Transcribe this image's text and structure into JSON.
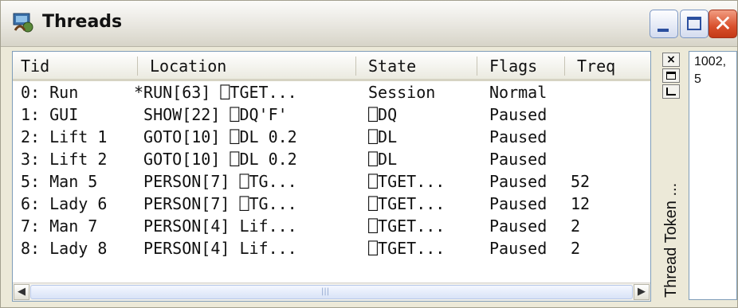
{
  "window": {
    "title": "Threads",
    "icon": "threads-app-icon",
    "controls": {
      "minimize": "minimize-icon",
      "maximize": "maximize-icon",
      "close": "close-icon",
      "close_glyph": "✕"
    }
  },
  "table": {
    "columns": [
      "Tid",
      "Location",
      "State",
      "Flags",
      "Treq"
    ],
    "rows": [
      [
        "0: Run",
        "*RUN[63] ⎕TGET...",
        "Session",
        "Normal",
        ""
      ],
      [
        "1: GUI",
        " SHOW[22] ⎕DQ'F'",
        "⎕DQ",
        "Paused",
        ""
      ],
      [
        "2: Lift 1",
        " GOTO[10] ⎕DL 0.2",
        "⎕DL",
        "Paused",
        ""
      ],
      [
        "3: Lift 2",
        " GOTO[10] ⎕DL 0.2",
        "⎕DL",
        "Paused",
        ""
      ],
      [
        "5: Man 5",
        " PERSON[7] ⎕TG...",
        "⎕TGET...",
        "Paused",
        "52"
      ],
      [
        "6: Lady 6",
        " PERSON[7] ⎕TG...",
        "⎕TGET...",
        "Paused",
        "12"
      ],
      [
        "7: Man 7",
        " PERSON[4] Lif...",
        "⎕TGET...",
        "Paused",
        "2"
      ],
      [
        "8: Lady 8",
        " PERSON[4] Lif...",
        "⎕TGET...",
        "Paused",
        "2"
      ]
    ]
  },
  "hscroll": {
    "left_glyph": "◀",
    "right_glyph": "▶",
    "grip_glyph": "|||"
  },
  "sidepanel": {
    "close_glyph": "×",
    "label": "Thread Token ...",
    "token_value": "1002,\n5"
  }
}
